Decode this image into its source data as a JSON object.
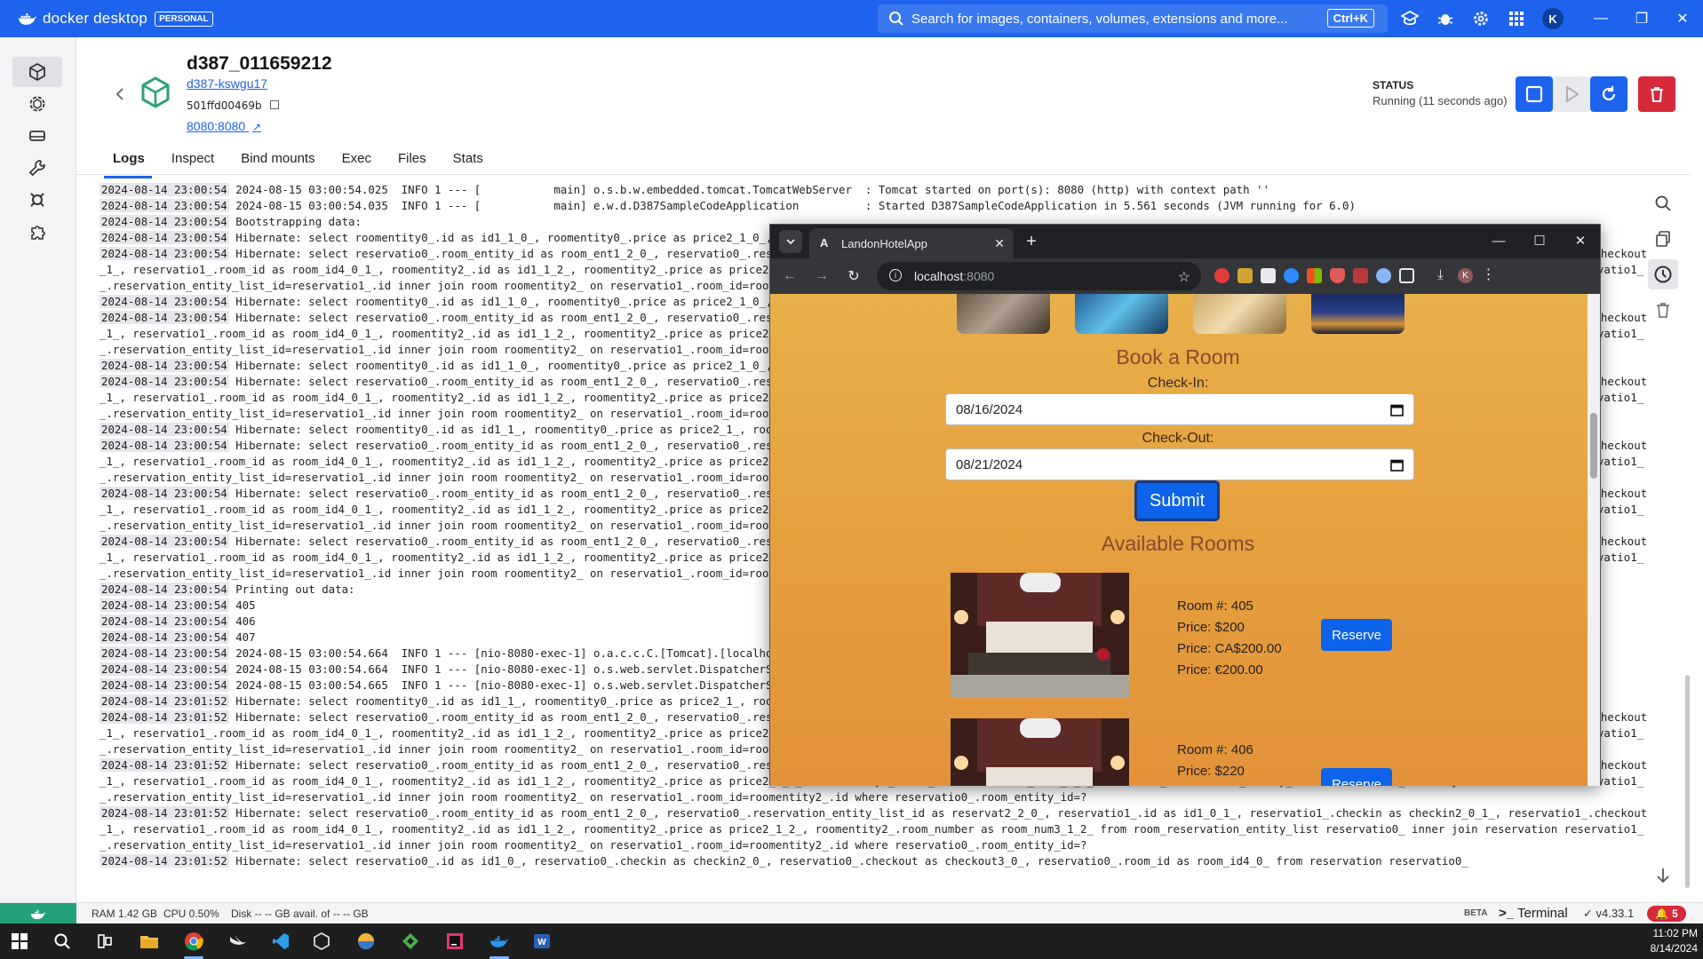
{
  "topbar": {
    "brand": "docker desktop",
    "plan_badge": "PERSONAL",
    "search_placeholder": "Search for images, containers, volumes, extensions and more...",
    "search_shortcut": "Ctrl+K",
    "avatar_initial": "K"
  },
  "container": {
    "name": "d387_011659212",
    "image_link": "d387-kswgu17",
    "id": "501ffd00469b",
    "port_link": "8080:8080",
    "status_label": "STATUS",
    "status_value": "Running (11 seconds ago)"
  },
  "tabs": [
    "Logs",
    "Inspect",
    "Bind mounts",
    "Exec",
    "Files",
    "Stats"
  ],
  "logs": [
    [
      "2024-08-14 23:00:54",
      "2024-08-15 03:00:54.025  INFO 1 --- [           main] o.s.b.w.embedded.tomcat.TomcatWebServer  : Tomcat started on port(s): 8080 (http) with context path ''"
    ],
    [
      "2024-08-14 23:00:54",
      "2024-08-15 03:00:54.035  INFO 1 --- [           main] e.w.d.D387SampleCodeApplication          : Started D387SampleCodeApplication in 5.561 seconds (JVM running for 6.0)"
    ],
    [
      "2024-08-14 23:00:54",
      "Bootstrapping data:"
    ],
    [
      "2024-08-14 23:00:54",
      "Hibernate: select roomentity0_.id as id1_1_0_, roomentity0_.price as price2_1_0_, roomentity0_.room_number as room_num3_1_0_ from room roomentity0_ where roomentity0_.id=?"
    ],
    [
      "2024-08-14 23:00:54",
      "Hibernate: select reservatio0_.room_entity_id as room_ent1_2_0_, reservatio0_.reservation_entity_list_id as reservat2_2_0_, reservatio1_.id as id1_0_1_, reservatio1_.checkin as checkin2_0_1_, reservatio1_.checkout as checkout3_0"
    ],
    [
      "",
      "_1_, reservatio1_.room_id as room_id4_0_1_, roomentity2_.id as id1_1_2_, roomentity2_.price as price2_1_2_, roomentity2_.room_number as room_num3_1_2_ from room_reservation_entity_list reservatio0_ inner join reservation reservatio1_ on reservatio0"
    ],
    [
      "",
      "_.reservation_entity_list_id=reservatio1_.id inner join room roomentity2_ on reservatio1_.room_id=roomentity2_.id where reservatio0_.room_entity_id=?"
    ],
    [
      "2024-08-14 23:00:54",
      "Hibernate: select roomentity0_.id as id1_1_0_, roomentity0_.price as price2_1_0_, roomentity0_.room_number as room_num3_1_0_ from room roomentity0_ where roomentity0_.id=?"
    ],
    [
      "2024-08-14 23:00:54",
      "Hibernate: select reservatio0_.room_entity_id as room_ent1_2_0_, reservatio0_.reservation_entity_list_id as reservat2_2_0_, reservatio1_.id as id1_0_1_, reservatio1_.checkin as checkin2_0_1_, reservatio1_.checkout as checkout3_0"
    ],
    [
      "",
      "_1_, reservatio1_.room_id as room_id4_0_1_, roomentity2_.id as id1_1_2_, roomentity2_.price as price2_1_2_, roomentity2_.room_number as room_num3_1_2_ from room_reservation_entity_list reservatio0_ inner join reservation reservatio1_ on reservatio0"
    ],
    [
      "",
      "_.reservation_entity_list_id=reservatio1_.id inner join room roomentity2_ on reservatio1_.room_id=roomentity2_.id where reservatio0_.room_entity_id=?"
    ],
    [
      "2024-08-14 23:00:54",
      "Hibernate: select roomentity0_.id as id1_1_0_, roomentity0_.price as price2_1_0_, roomentity0_.room_number as room_num3_1_0_ from room roomentity0_ where roomentity0_.id=?"
    ],
    [
      "2024-08-14 23:00:54",
      "Hibernate: select reservatio0_.room_entity_id as room_ent1_2_0_, reservatio0_.reservation_entity_list_id as reservat2_2_0_, reservatio1_.id as id1_0_1_, reservatio1_.checkin as checkin2_0_1_, reservatio1_.checkout as checkout3_0"
    ],
    [
      "",
      "_1_, reservatio1_.room_id as room_id4_0_1_, roomentity2_.id as id1_1_2_, roomentity2_.price as price2_1_2_, roomentity2_.room_number as room_num3_1_2_ from room_reservation_entity_list reservatio0_ inner join reservation reservatio1_ on reservatio0"
    ],
    [
      "",
      "_.reservation_entity_list_id=reservatio1_.id inner join room roomentity2_ on reservatio1_.room_id=roomentity2_.id where reservatio0_.room_entity_id=?"
    ],
    [
      "2024-08-14 23:00:54",
      "Hibernate: select roomentity0_.id as id1_1_, roomentity0_.price as price2_1_, roomentity0_.room_number as room_num3_1_ from room roomentity0_"
    ],
    [
      "2024-08-14 23:00:54",
      "Hibernate: select reservatio0_.room_entity_id as room_ent1_2_0_, reservatio0_.reservation_entity_list_id as reservat2_2_0_, reservatio1_.id as id1_0_1_, reservatio1_.checkin as checkin2_0_1_, reservatio1_.checkout as checkout3_0"
    ],
    [
      "",
      "_1_, reservatio1_.room_id as room_id4_0_1_, roomentity2_.id as id1_1_2_, roomentity2_.price as price2_1_2_, roomentity2_.room_number as room_num3_1_2_ from room_reservation_entity_list reservatio0_ inner join reservation reservatio1_ on reservatio0"
    ],
    [
      "",
      "_.reservation_entity_list_id=reservatio1_.id inner join room roomentity2_ on reservatio1_.room_id=roomentity2_.id where reservatio0_.room_entity_id=?"
    ],
    [
      "2024-08-14 23:00:54",
      "Hibernate: select reservatio0_.room_entity_id as room_ent1_2_0_, reservatio0_.reservation_entity_list_id as reservat2_2_0_, reservatio1_.id as id1_0_1_, reservatio1_.checkin as checkin2_0_1_, reservatio1_.checkout as checkout3_0"
    ],
    [
      "",
      "_1_, reservatio1_.room_id as room_id4_0_1_, roomentity2_.id as id1_1_2_, roomentity2_.price as price2_1_2_, roomentity2_.room_number as room_num3_1_2_ from room_reservation_entity_list reservatio0_ inner join reservation reservatio1_ on reservatio0"
    ],
    [
      "",
      "_.reservation_entity_list_id=reservatio1_.id inner join room roomentity2_ on reservatio1_.room_id=roomentity2_.id where reservatio0_.room_entity_id=?"
    ],
    [
      "2024-08-14 23:00:54",
      "Hibernate: select reservatio0_.room_entity_id as room_ent1_2_0_, reservatio0_.reservation_entity_list_id as reservat2_2_0_, reservatio1_.id as id1_0_1_, reservatio1_.checkin as checkin2_0_1_, reservatio1_.checkout as checkout3_0"
    ],
    [
      "",
      "_1_, reservatio1_.room_id as room_id4_0_1_, roomentity2_.id as id1_1_2_, roomentity2_.price as price2_1_2_, roomentity2_.room_number as room_num3_1_2_ from room_reservation_entity_list reservatio0_ inner join reservation reservatio1_ on reservatio0"
    ],
    [
      "",
      "_.reservation_entity_list_id=reservatio1_.id inner join room roomentity2_ on reservatio1_.room_id=roomentity2_.id where reservatio0_.room_entity_id=?"
    ],
    [
      "2024-08-14 23:00:54",
      "Printing out data:"
    ],
    [
      "2024-08-14 23:00:54",
      "405"
    ],
    [
      "2024-08-14 23:00:54",
      "406"
    ],
    [
      "2024-08-14 23:00:54",
      "407"
    ],
    [
      "2024-08-14 23:00:54",
      "2024-08-15 03:00:54.664  INFO 1 --- [nio-8080-exec-1] o.a.c.c.C.[Tomcat].[localhost].[/]       : Initializing Spring DispatcherServlet 'dispatcherServlet'"
    ],
    [
      "2024-08-14 23:00:54",
      "2024-08-15 03:00:54.664  INFO 1 --- [nio-8080-exec-1] o.s.web.servlet.DispatcherServlet        : Initializing Servlet 'dispatcherServlet'"
    ],
    [
      "2024-08-14 23:00:54",
      "2024-08-15 03:00:54.665  INFO 1 --- [nio-8080-exec-1] o.s.web.servlet.DispatcherServlet        : Completed initialization in 1 ms"
    ],
    [
      "2024-08-14 23:01:52",
      "Hibernate: select roomentity0_.id as id1_1_, roomentity0_.price as price2_1_, roomentity0_.room_number as room_num3_1_ from room roomentity0_"
    ],
    [
      "2024-08-14 23:01:52",
      "Hibernate: select reservatio0_.room_entity_id as room_ent1_2_0_, reservatio0_.reservation_entity_list_id as reservat2_2_0_, reservatio1_.id as id1_0_1_, reservatio1_.checkin as checkin2_0_1_, reservatio1_.checkout as checkout3_0"
    ],
    [
      "",
      "_1_, reservatio1_.room_id as room_id4_0_1_, roomentity2_.id as id1_1_2_, roomentity2_.price as price2_1_2_, roomentity2_.room_number as room_num3_1_2_ from room_reservation_entity_list reservatio0_ inner join reservation reservatio1_ on reservatio0"
    ],
    [
      "",
      "_.reservation_entity_list_id=reservatio1_.id inner join room roomentity2_ on reservatio1_.room_id=roomentity2_.id where reservatio0_.room_entity_id=?"
    ],
    [
      "2024-08-14 23:01:52",
      "Hibernate: select reservatio0_.room_entity_id as room_ent1_2_0_, reservatio0_.reservation_entity_list_id as reservat2_2_0_, reservatio1_.id as id1_0_1_, reservatio1_.checkin as checkin2_0_1_, reservatio1_.checkout as checkout3_0"
    ],
    [
      "",
      "_1_, reservatio1_.room_id as room_id4_0_1_, roomentity2_.id as id1_1_2_, roomentity2_.price as price2_1_2_, roomentity2_.room_number as room_num3_1_2_ from room_reservation_entity_list reservatio0_ inner join reservation reservatio1_ on reservatio0"
    ],
    [
      "",
      "_.reservation_entity_list_id=reservatio1_.id inner join room roomentity2_ on reservatio1_.room_id=roomentity2_.id where reservatio0_.room_entity_id=?"
    ],
    [
      "2024-08-14 23:01:52",
      "Hibernate: select reservatio0_.room_entity_id as room_ent1_2_0_, reservatio0_.reservation_entity_list_id as reservat2_2_0_, reservatio1_.id as id1_0_1_, reservatio1_.checkin as checkin2_0_1_, reservatio1_.checkout as checkout3_0"
    ],
    [
      "",
      "_1_, reservatio1_.room_id as room_id4_0_1_, roomentity2_.id as id1_1_2_, roomentity2_.price as price2_1_2_, roomentity2_.room_number as room_num3_1_2_ from room_reservation_entity_list reservatio0_ inner join reservation reservatio1_ on reservatio0"
    ],
    [
      "",
      "_.reservation_entity_list_id=reservatio1_.id inner join room roomentity2_ on reservatio1_.room_id=roomentity2_.id where reservatio0_.room_entity_id=?"
    ],
    [
      "2024-08-14 23:01:52",
      "Hibernate: select reservatio0_.id as id1_0_, reservatio0_.checkin as checkin2_0_, reservatio0_.checkout as checkout3_0_, reservatio0_.room_id as room_id4_0_ from reservation reservatio0_"
    ]
  ],
  "statusbar": {
    "ram": "RAM 1.42 GB",
    "cpu": "CPU 0.50%",
    "disk": "Disk -- -- GB avail. of -- -- GB",
    "beta": "BETA",
    "terminal": "Terminal",
    "version": "v4.33.1",
    "notifications": "5"
  },
  "taskbar": {
    "time": "11:02 PM",
    "date": "8/14/2024"
  },
  "browser": {
    "tab_title": "LandonHotelApp",
    "url_host": "localhost",
    "url_port": ":8080",
    "profile_initial": "K"
  },
  "page": {
    "book_title": "Book a Room",
    "checkin_label": "Check-In:",
    "checkin_value": "08/16/2024",
    "checkout_label": "Check-Out:",
    "checkout_value": "08/21/2024",
    "submit_label": "Submit",
    "available_title": "Available Rooms",
    "rooms": [
      {
        "number": "Room #: 405",
        "price": "Price: $200",
        "price_cad": "Price: CA$200.00",
        "price_eur": "Price: €200.00",
        "reserve": "Reserve"
      },
      {
        "number": "Room #: 406",
        "price": "Price: $220",
        "reserve": "Reserve"
      }
    ]
  }
}
